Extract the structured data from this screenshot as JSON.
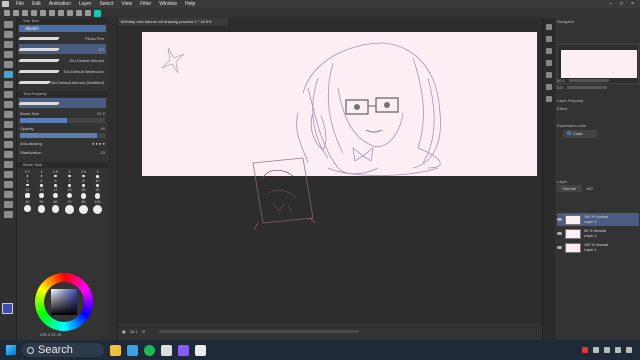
{
  "menu": {
    "items": [
      "File",
      "Edit",
      "Animation",
      "Layer",
      "Select",
      "View",
      "Filter",
      "Window",
      "Help"
    ]
  },
  "document": {
    "tab_title": "birthday new banner art drawing process 2 * 18.8%"
  },
  "sub_tool": {
    "header": "Sub Tool",
    "search": "Sketch",
    "brushes": [
      {
        "label": "Photo Pen",
        "selected": false
      },
      {
        "label": "3.7",
        "selected": true
      },
      {
        "label": "SAI Default Abirush",
        "selected": false
      },
      {
        "label": "SAI Default Watercolor",
        "selected": false
      },
      {
        "label": "SAI Default Abirush (Modified)",
        "selected": false
      }
    ]
  },
  "tool_property": {
    "header": "Tool Property",
    "brush_size_label": "Brush Size",
    "brush_size_value": "51.5",
    "opacity_label": "Opacity",
    "opacity_value": "90",
    "anti_aliasing_label": "Anti-aliasing",
    "stabilization_label": "Stabilization",
    "stabilization_value": "15"
  },
  "brush_size_palette": {
    "header": "Brush Size",
    "sizes": [
      "0.7",
      "1",
      "1.5",
      "2",
      "2.5",
      "3",
      "4",
      "5",
      "6",
      "7",
      "8",
      "10",
      "12",
      "15",
      "17",
      "20",
      "25",
      "30",
      "40",
      "50",
      "60",
      "70",
      "80",
      "100"
    ]
  },
  "color": {
    "main_hex": "#3d4db3",
    "footer": "235 0 32 45"
  },
  "navigator": {
    "header": "Navigator",
    "zoom_value": "20.1",
    "angle_value": "0.0"
  },
  "layer_property": {
    "header": "Layer Property",
    "effect_label": "Effect",
    "expression_label": "Expression color",
    "expression_value": "Color"
  },
  "layers": {
    "header": "Layer",
    "blend_mode": "Normal",
    "opacity": "100",
    "items": [
      {
        "line1": "100 % Normal",
        "line2": "Layer 3",
        "selected": true
      },
      {
        "line1": "50 % Normal",
        "line2": "Layer 2",
        "selected": false
      },
      {
        "line1": "100 % Normal",
        "line2": "Layer 1",
        "selected": false
      }
    ]
  },
  "canvas_status": {
    "zoom": "28.1"
  },
  "taskbar": {
    "search_label": "Search"
  },
  "accents": {
    "artboard": "#fbeef5",
    "selection": "#4a5d80",
    "teal": "#1cc7b0"
  }
}
